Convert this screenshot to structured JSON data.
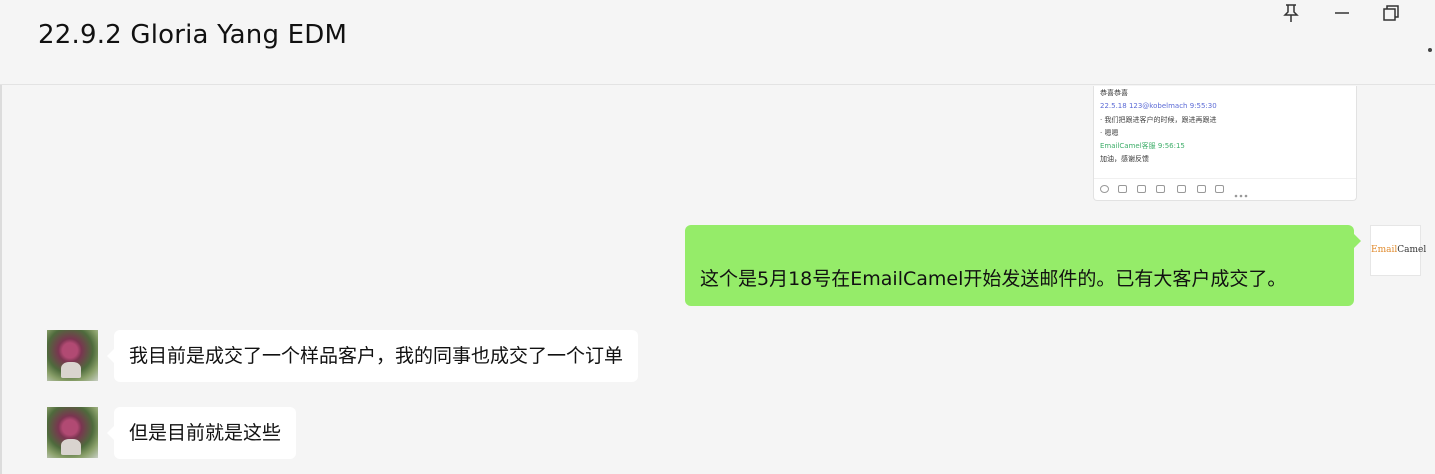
{
  "window": {
    "title": "22.9.2 Gloria Yang EDM",
    "controls": [
      "pin-icon",
      "minimize-icon",
      "restore-icon"
    ]
  },
  "messages": [
    {
      "direction": "outgoing",
      "type": "image",
      "image_lines": [
        {
          "text": "恭喜恭喜",
          "color": "#333333"
        },
        {
          "text": "22.5.18 123@kobelmach 9:55:30",
          "color": "#5c6bd6"
        },
        {
          "text": "· 我们把跟进客户的时候，跟进再跟进",
          "color": "#444444"
        },
        {
          "text": "· 嗯嗯",
          "color": "#444444"
        },
        {
          "text": "EmailCamel客服 9:56:15",
          "color": "#3fae6a"
        },
        {
          "text": "加油，感谢反馈",
          "color": "#333333"
        }
      ]
    },
    {
      "direction": "outgoing",
      "type": "text",
      "text": "这个是5月18号在EmailCamel开始发送邮件的。已有大客户成交了。",
      "sender_avatar": {
        "part1": "Email",
        "part2": "Camel"
      }
    },
    {
      "direction": "incoming",
      "type": "text",
      "text": "我目前是成交了一个样品客户，我的同事也成交了一个订单"
    },
    {
      "direction": "incoming",
      "type": "text",
      "text": "但是目前就是这些"
    }
  ],
  "colors": {
    "background": "#f5f5f5",
    "outgoing_bubble": "#95ec69",
    "incoming_bubble": "#ffffff"
  }
}
